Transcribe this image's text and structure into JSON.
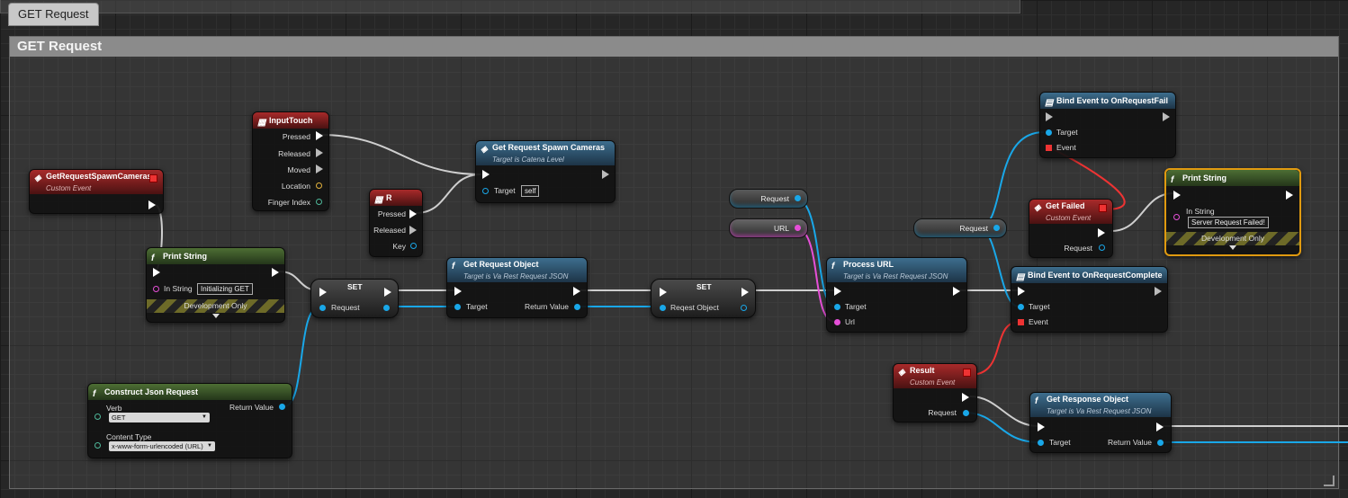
{
  "tab": {
    "label": "GET Request"
  },
  "comment": {
    "title": "GET Request"
  },
  "nodes": {
    "get_request_spawn_cameras_event": {
      "title": "GetRequestSpawnCameras",
      "subtitle": "Custom Event"
    },
    "input_touch": {
      "title": "InputTouch",
      "pins": [
        "Pressed",
        "Released",
        "Moved",
        "Location",
        "Finger Index"
      ]
    },
    "r_key": {
      "title": "R",
      "pins": [
        "Pressed",
        "Released",
        "Key"
      ]
    },
    "get_request_spawn_cameras_call": {
      "title": "Get Request Spawn Cameras",
      "subtitle": "Target is Catena Level",
      "target_label": "Target",
      "target_value": "self"
    },
    "print_string_1": {
      "title": "Print String",
      "in_string_label": "In String",
      "in_string_value": "Initializing GET",
      "dev_only": "Development Only"
    },
    "set_1": {
      "title": "SET",
      "pin": "Request"
    },
    "get_request_object_1": {
      "title": "Get Request Object",
      "subtitle": "Target is Va Rest Request JSON",
      "target": "Target",
      "return": "Return Value"
    },
    "set_2": {
      "title": "SET",
      "pin": "Reqest Object"
    },
    "construct_json": {
      "title": "Construct Json Request",
      "verb_label": "Verb",
      "verb_value": "GET",
      "content_type_label": "Content Type",
      "content_type_value": "x-www-form-urlencoded (URL)",
      "return": "Return Value"
    },
    "var_request_1": {
      "label": "Request"
    },
    "var_url": {
      "label": "URL"
    },
    "process_url": {
      "title": "Process URL",
      "subtitle": "Target is Va Rest Request JSON",
      "target": "Target",
      "url": "Url"
    },
    "var_request_2": {
      "label": "Request"
    },
    "bind_fail": {
      "title": "Bind Event to OnRequestFail",
      "target": "Target",
      "event": "Event"
    },
    "get_failed": {
      "title": "Get Failed",
      "subtitle": "Custom Event",
      "request": "Request"
    },
    "print_string_2": {
      "title": "Print String",
      "in_string_label": "In String",
      "in_string_value": "Server Request Failed!",
      "dev_only": "Development Only"
    },
    "bind_complete": {
      "title": "Bind Event to OnRequestComplete",
      "target": "Target",
      "event": "Event"
    },
    "result_event": {
      "title": "Result",
      "subtitle": "Custom Event",
      "request": "Request"
    },
    "get_response_object": {
      "title": "Get Response Object",
      "subtitle": "Target is Va Rest Request JSON",
      "target": "Target",
      "return": "Return Value"
    }
  },
  "colors": {
    "exec": "#ffffff",
    "object_pin": "#19a7e8",
    "string_pin": "#e64fd8",
    "event_pin": "#e33333",
    "selected": "#e09a10"
  }
}
